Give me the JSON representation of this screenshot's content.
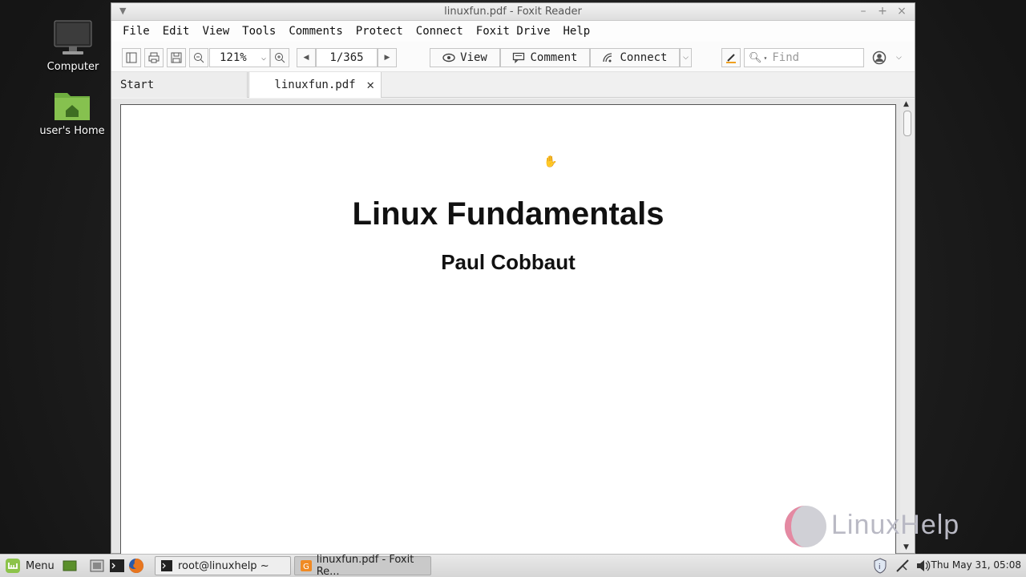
{
  "desktop": {
    "icons": [
      {
        "label": "Computer",
        "icon": "computer-monitor-icon"
      },
      {
        "label": "user's Home",
        "icon": "home-folder-icon"
      }
    ]
  },
  "window": {
    "title": "linuxfun.pdf - Foxit Reader",
    "menu": [
      "File",
      "Edit",
      "View",
      "Tools",
      "Comments",
      "Protect",
      "Connect",
      "Foxit Drive",
      "Help"
    ],
    "toolbar": {
      "zoom_value": "121%",
      "page_value": "1/365",
      "modes": [
        "View",
        "Comment",
        "Connect"
      ],
      "find_placeholder": "Find"
    },
    "tabs": {
      "start_label": "Start",
      "active_label": "linuxfun.pdf"
    }
  },
  "document": {
    "title": "Linux Fundamentals",
    "author": "Paul Cobbaut"
  },
  "watermark": {
    "text": "LinuxHelp"
  },
  "taskbar": {
    "menu_label": "Menu",
    "tasks": [
      "root@linuxhelp ~",
      "linuxfun.pdf - Foxit Re..."
    ],
    "clock": "Thu May 31, 05:08"
  }
}
